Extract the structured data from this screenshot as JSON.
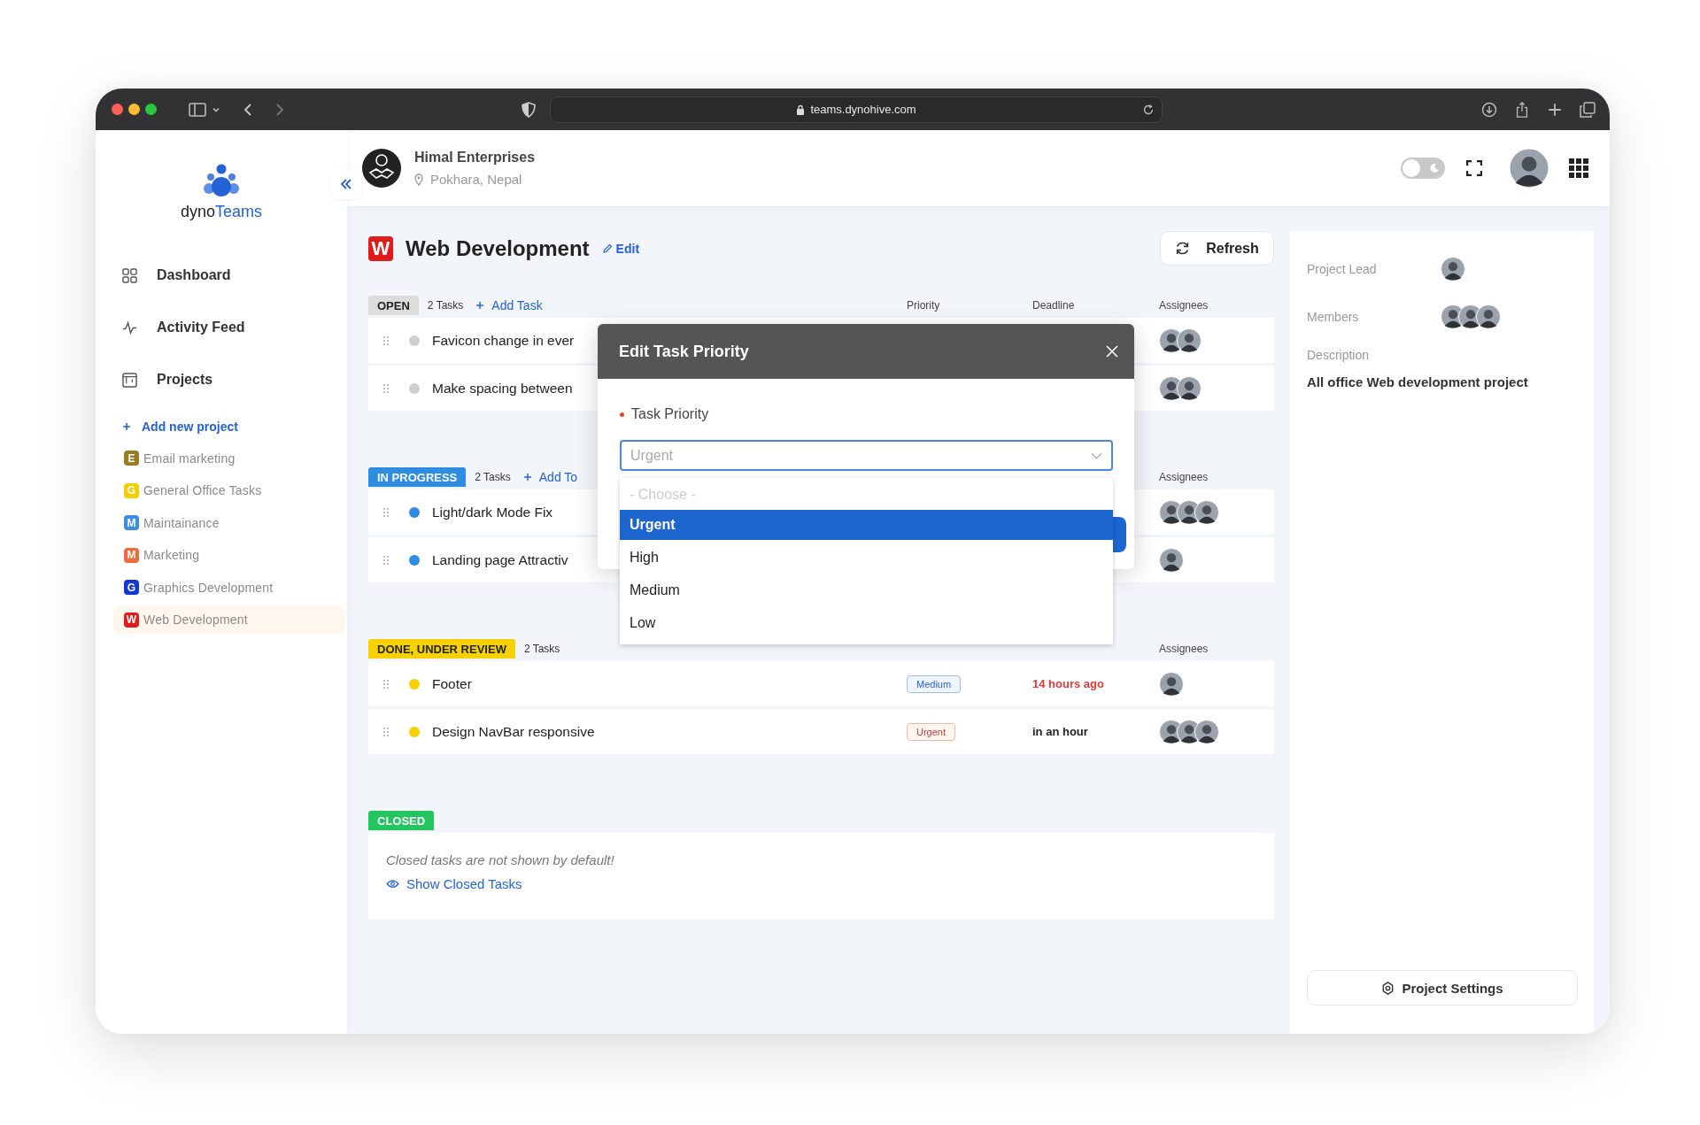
{
  "browser": {
    "url": "teams.dynohive.com"
  },
  "sidebar": {
    "logo": {
      "prefix": "dyno",
      "suffix": "Teams"
    },
    "nav": [
      {
        "label": "Dashboard"
      },
      {
        "label": "Activity Feed"
      },
      {
        "label": "Projects"
      }
    ],
    "add_project": "Add new project",
    "projects": [
      {
        "letter": "E",
        "name": "Email marketing",
        "color": "#9a7b22",
        "selected": false
      },
      {
        "letter": "G",
        "name": "General Office Tasks",
        "color": "#f2cf00",
        "selected": false
      },
      {
        "letter": "M",
        "name": "Maintainance",
        "color": "#3b8fe0",
        "selected": false
      },
      {
        "letter": "M",
        "name": "Marketing",
        "color": "#f06a3a",
        "selected": false
      },
      {
        "letter": "G",
        "name": "Graphics Development",
        "color": "#1239d8",
        "selected": false
      },
      {
        "letter": "W",
        "name": "Web Development",
        "color": "#e01b1b",
        "selected": true
      }
    ]
  },
  "header": {
    "company": "Himal Enterprises",
    "location": "Pokhara, Nepal",
    "dark_mode": false
  },
  "project": {
    "letter": "W",
    "color": "#e01b1b",
    "title": "Web Development",
    "edit": "Edit",
    "refresh": "Refresh"
  },
  "groups": [
    {
      "status": "OPEN",
      "color": "#dcdcdc",
      "count": "2 Tasks",
      "add_task": "Add Task",
      "columns": {
        "priority": "Priority",
        "deadline": "Deadline",
        "assignees": "Assignees"
      },
      "tasks": [
        {
          "title": "Favicon change in ever",
          "color": "#cfcfcf"
        },
        {
          "title": "Make spacing between",
          "color": "#cfcfcf"
        }
      ]
    },
    {
      "status": "IN PROGRESS",
      "color": "#2e8de0",
      "count": "2 Tasks",
      "add_task": "Add To",
      "columns": {
        "assignees": "Assignees"
      },
      "tasks": [
        {
          "title": "Light/dark Mode Fix",
          "color": "#2e8de0"
        },
        {
          "title": "Landing page Attractiv",
          "color": "#2e8de0"
        }
      ]
    },
    {
      "status": "DONE, UNDER REVIEW",
      "color": "#f7d200",
      "count": "2 Tasks",
      "columns": {
        "assignees": "Assignees"
      },
      "tasks": [
        {
          "title": "Footer",
          "color": "#f7d200",
          "priority": {
            "label": "Medium",
            "kind": "medium"
          },
          "deadline": "14 hours ago",
          "overdue": true
        },
        {
          "title": "Design NavBar responsive",
          "color": "#f7d200",
          "priority": {
            "label": "Urgent",
            "kind": "urgent"
          },
          "deadline": "in an hour",
          "overdue": false
        }
      ]
    }
  ],
  "closed": {
    "status": "CLOSED",
    "color": "#22c55e",
    "note": "Closed tasks are not shown by default!",
    "show_link": "Show Closed Tasks"
  },
  "info": {
    "lead_label": "Project Lead",
    "members_label": "Members",
    "description_label": "Description",
    "description": "All office Web development project",
    "settings": "Project Settings"
  },
  "modal": {
    "title": "Edit Task Priority",
    "field_label": "Task Priority",
    "required": true,
    "value": "Urgent",
    "options": [
      {
        "label": "- Choose -",
        "kind": "placeholder",
        "selected": false
      },
      {
        "label": "Urgent",
        "kind": "option",
        "selected": true
      },
      {
        "label": "High",
        "kind": "option",
        "selected": false
      },
      {
        "label": "Medium",
        "kind": "option",
        "selected": false
      },
      {
        "label": "Low",
        "kind": "option",
        "selected": false
      }
    ]
  }
}
